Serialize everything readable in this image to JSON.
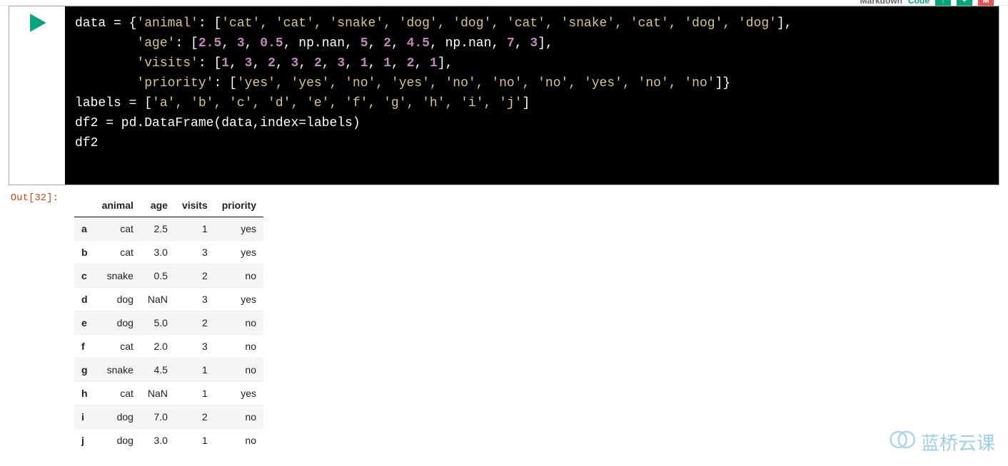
{
  "toolbar": {
    "markdown_label": "Markdown",
    "code_label": "Code",
    "btn_up": "↑",
    "btn_plus": "+",
    "btn_m": "M"
  },
  "code": {
    "l1_a": "data = {",
    "l1_k1": "'animal'",
    "l1_b": ": [",
    "l1_v": "'cat', 'cat', 'snake', 'dog', 'dog', 'cat', 'snake', 'cat', 'dog', 'dog'",
    "l1_c": "],",
    "l2_a": "        ",
    "l2_k": "'age'",
    "l2_b": ": [",
    "l2_n1": "2.5",
    "l2_s1": ", ",
    "l2_n2": "3",
    "l2_s2": ", ",
    "l2_n3": "0.5",
    "l2_s3": ", np.nan, ",
    "l2_n4": "5",
    "l2_s4": ", ",
    "l2_n5": "2",
    "l2_s5": ", ",
    "l2_n6": "4.5",
    "l2_s6": ", np.nan, ",
    "l2_n7": "7",
    "l2_s7": ", ",
    "l2_n8": "3",
    "l2_c": "],",
    "l3_a": "        ",
    "l3_k": "'visits'",
    "l3_b": ": [",
    "l3_n1": "1",
    "l3_s1": ", ",
    "l3_n2": "3",
    "l3_s2": ", ",
    "l3_n3": "2",
    "l3_s3": ", ",
    "l3_n4": "3",
    "l3_s4": ", ",
    "l3_n5": "2",
    "l3_s5": ", ",
    "l3_n6": "3",
    "l3_s6": ", ",
    "l3_n7": "1",
    "l3_s7": ", ",
    "l3_n8": "1",
    "l3_s8": ", ",
    "l3_n9": "2",
    "l3_s9": ", ",
    "l3_n10": "1",
    "l3_c": "],",
    "l4_a": "        ",
    "l4_k": "'priority'",
    "l4_b": ": [",
    "l4_v": "'yes', 'yes', 'no', 'yes', 'no', 'no', 'no', 'yes', 'no', 'no'",
    "l4_c": "]}",
    "l5_a": "labels = [",
    "l5_v": "'a', 'b', 'c', 'd', 'e', 'f', 'g', 'h', 'i', 'j'",
    "l5_c": "]",
    "l6": "df2 = pd.DataFrame(data,index=labels)",
    "l7": "df2"
  },
  "output": {
    "prompt": "Out[32]:",
    "columns": [
      "animal",
      "age",
      "visits",
      "priority"
    ],
    "index": [
      "a",
      "b",
      "c",
      "d",
      "e",
      "f",
      "g",
      "h",
      "i",
      "j"
    ],
    "rows": [
      [
        "cat",
        "2.5",
        "1",
        "yes"
      ],
      [
        "cat",
        "3.0",
        "3",
        "yes"
      ],
      [
        "snake",
        "0.5",
        "2",
        "no"
      ],
      [
        "dog",
        "NaN",
        "3",
        "yes"
      ],
      [
        "dog",
        "5.0",
        "2",
        "no"
      ],
      [
        "cat",
        "2.0",
        "3",
        "no"
      ],
      [
        "snake",
        "4.5",
        "1",
        "no"
      ],
      [
        "cat",
        "NaN",
        "1",
        "yes"
      ],
      [
        "dog",
        "7.0",
        "2",
        "no"
      ],
      [
        "dog",
        "3.0",
        "1",
        "no"
      ]
    ]
  },
  "watermark": {
    "text": "蓝桥云课"
  }
}
